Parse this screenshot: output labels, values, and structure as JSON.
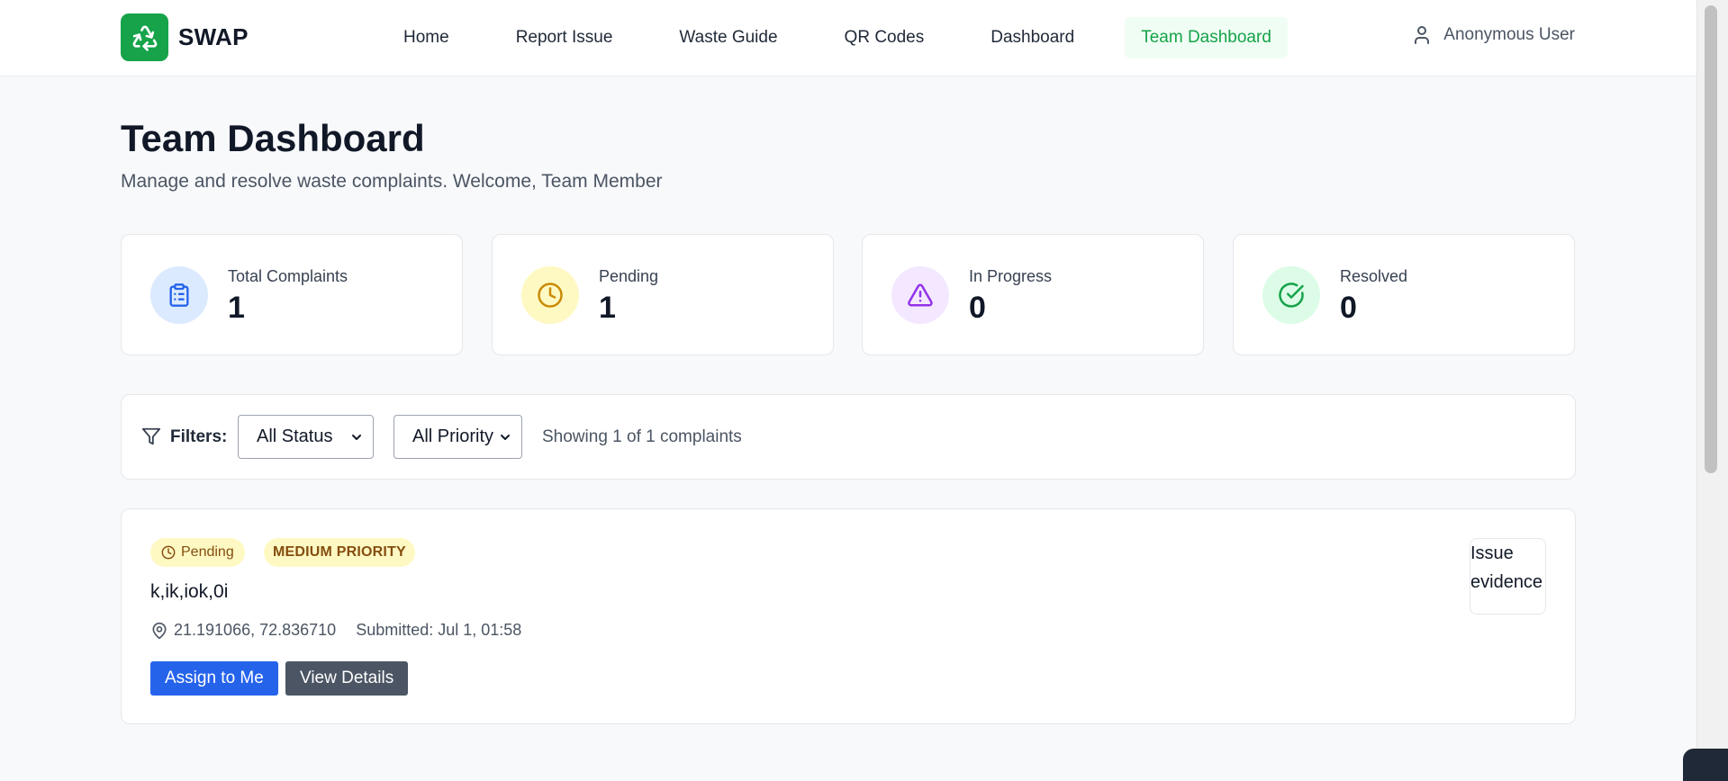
{
  "brand": {
    "name": "SWAP",
    "logo_icon": "recycle-icon",
    "color": "#16a34a"
  },
  "nav": {
    "items": [
      {
        "label": "Home"
      },
      {
        "label": "Report Issue"
      },
      {
        "label": "Waste Guide"
      },
      {
        "label": "QR Codes"
      },
      {
        "label": "Dashboard"
      },
      {
        "label": "Team Dashboard",
        "active": true
      }
    ]
  },
  "user": {
    "name": "Anonymous User",
    "icon": "user-icon"
  },
  "page": {
    "title": "Team Dashboard",
    "subtitle": "Manage and resolve waste complaints. Welcome, Team Member"
  },
  "stats": [
    {
      "label": "Total Complaints",
      "value": "1",
      "icon": "clipboard-icon",
      "color": "#2563eb",
      "bg": "#dbeafe"
    },
    {
      "label": "Pending",
      "value": "1",
      "icon": "clock-icon",
      "color": "#ca8a04",
      "bg": "#fef9c3"
    },
    {
      "label": "In Progress",
      "value": "0",
      "icon": "alert-triangle-icon",
      "color": "#9333ea",
      "bg": "#f3e8ff"
    },
    {
      "label": "Resolved",
      "value": "0",
      "icon": "check-circle-icon",
      "color": "#16a34a",
      "bg": "#dcfce7"
    }
  ],
  "filters": {
    "label": "Filters:",
    "status_select": "All Status",
    "priority_select": "All Priority",
    "showing": "Showing 1 of 1 complaints"
  },
  "complaint": {
    "status": "Pending",
    "priority": "MEDIUM PRIORITY",
    "title": "k,ik,iok,0i",
    "location": "21.191066, 72.836710",
    "submitted": "Submitted: Jul 1, 01:58",
    "evidence_alt": "Issue evidence",
    "assign_label": "Assign to Me",
    "details_label": "View Details"
  }
}
